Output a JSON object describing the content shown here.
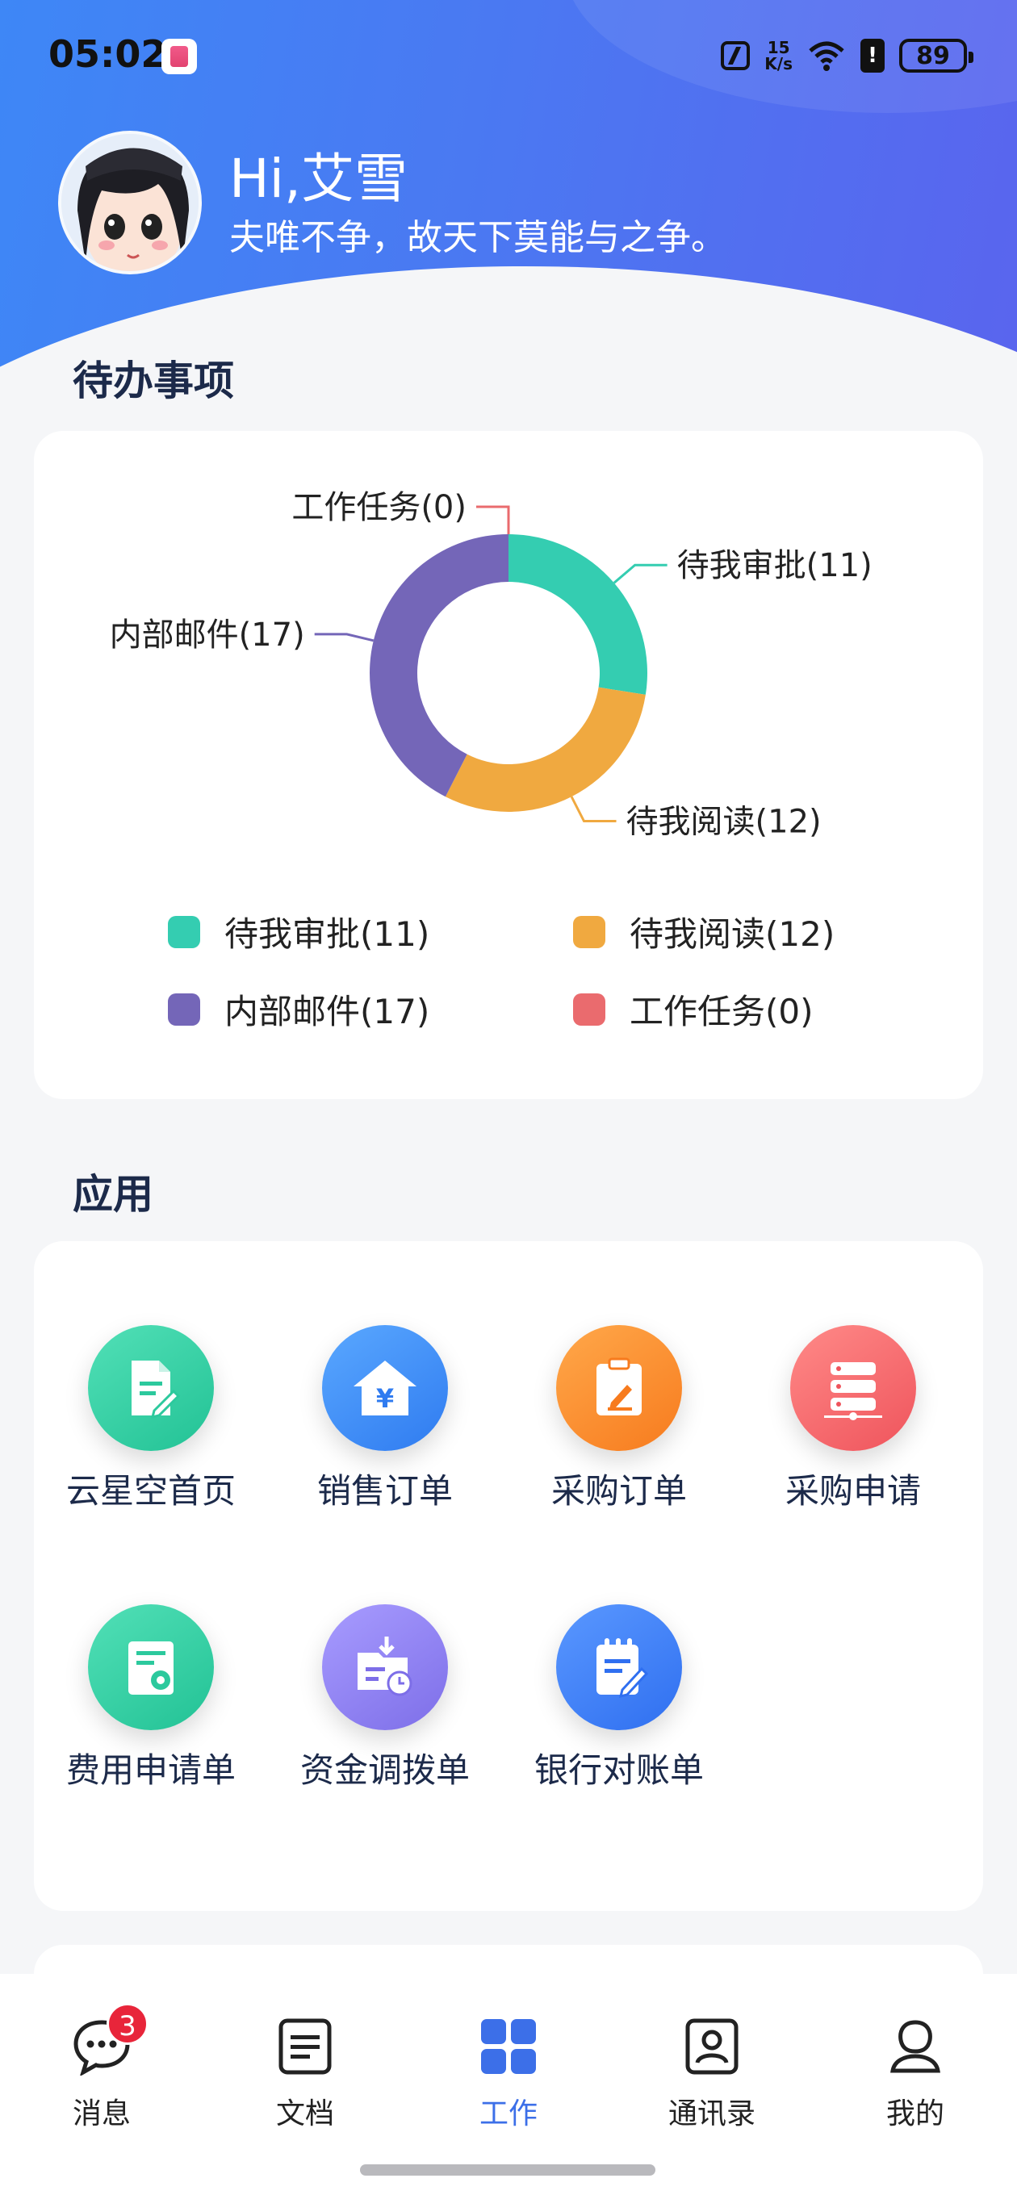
{
  "status_bar": {
    "time": "05:02",
    "net_speed_value": "15",
    "net_speed_unit": "K/s",
    "battery": "89",
    "alert_symbol": "!"
  },
  "profile": {
    "greeting": "Hi,艾雪",
    "motto": "夫唯不争，故天下莫能与之争。"
  },
  "todo": {
    "title": "待办事项",
    "items": [
      {
        "label": "待我审批(11)",
        "name": "待我审批",
        "count": 11,
        "color": "#34cdb1"
      },
      {
        "label": "待我阅读(12)",
        "name": "待我阅读",
        "count": 12,
        "color": "#f0a940"
      },
      {
        "label": "内部邮件(17)",
        "name": "内部邮件",
        "count": 17,
        "color": "#7466b8"
      },
      {
        "label": "工作任务(0)",
        "name": "工作任务",
        "count": 0,
        "color": "#ea6b6e"
      }
    ]
  },
  "chart_data": {
    "type": "pie",
    "categories": [
      "待我审批",
      "待我阅读",
      "内部邮件",
      "工作任务"
    ],
    "values": [
      11,
      12,
      17,
      0
    ],
    "labels": [
      "待我审批(11)",
      "待我阅读(12)",
      "内部邮件(17)",
      "工作任务(0)"
    ],
    "colors": [
      "#34cdb1",
      "#f0a940",
      "#7466b8",
      "#ea6b6e"
    ],
    "donut": true,
    "legend_position": "bottom"
  },
  "apps": {
    "title": "应用",
    "items": [
      {
        "label": "云星空首页",
        "icon": "document-edit-icon",
        "color": "#2fcea3"
      },
      {
        "label": "销售订单",
        "icon": "house-yen-icon",
        "color": "#3d8ef5"
      },
      {
        "label": "采购订单",
        "icon": "clipboard-edit-icon",
        "color": "#fb8a2c"
      },
      {
        "label": "采购申请",
        "icon": "server-list-icon",
        "color": "#f4676d"
      },
      {
        "label": "费用申请单",
        "icon": "document-view-icon",
        "color": "#2fcea3"
      },
      {
        "label": "资金调拨单",
        "icon": "folder-clock-icon",
        "color": "#8c7ef0"
      },
      {
        "label": "银行对账单",
        "icon": "notepad-edit-icon",
        "color": "#3f83f2"
      }
    ]
  },
  "tabbar": {
    "items": [
      {
        "label": "消息",
        "icon": "chat-icon",
        "badge": "3"
      },
      {
        "label": "文档",
        "icon": "document-icon"
      },
      {
        "label": "工作",
        "icon": "grid-icon",
        "active": true
      },
      {
        "label": "通讯录",
        "icon": "contact-icon"
      },
      {
        "label": "我的",
        "icon": "user-icon"
      }
    ]
  }
}
